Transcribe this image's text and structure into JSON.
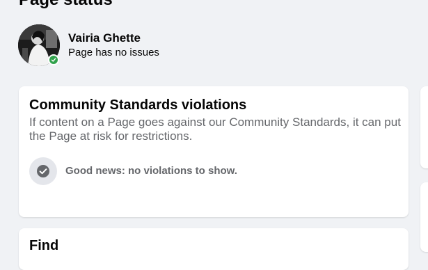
{
  "page": {
    "title": "Page status"
  },
  "profile": {
    "name": "Vairia Ghette",
    "status": "Page has no issues",
    "status_color": "#31a24c"
  },
  "violations_card": {
    "title": "Community Standards violations",
    "description": "If content on a Page goes against our Community Standards, it can put the Page at risk for restrictions.",
    "result_icon": "checkmark-icon",
    "result_text": "Good news: no violations to show."
  },
  "next_card": {
    "title": "Find"
  },
  "colors": {
    "background": "#f0f2f5",
    "card": "#ffffff",
    "primary_text": "#050505",
    "secondary_text": "#65676b",
    "icon_circle": "#e4e6eb",
    "online_green": "#31a24c"
  }
}
